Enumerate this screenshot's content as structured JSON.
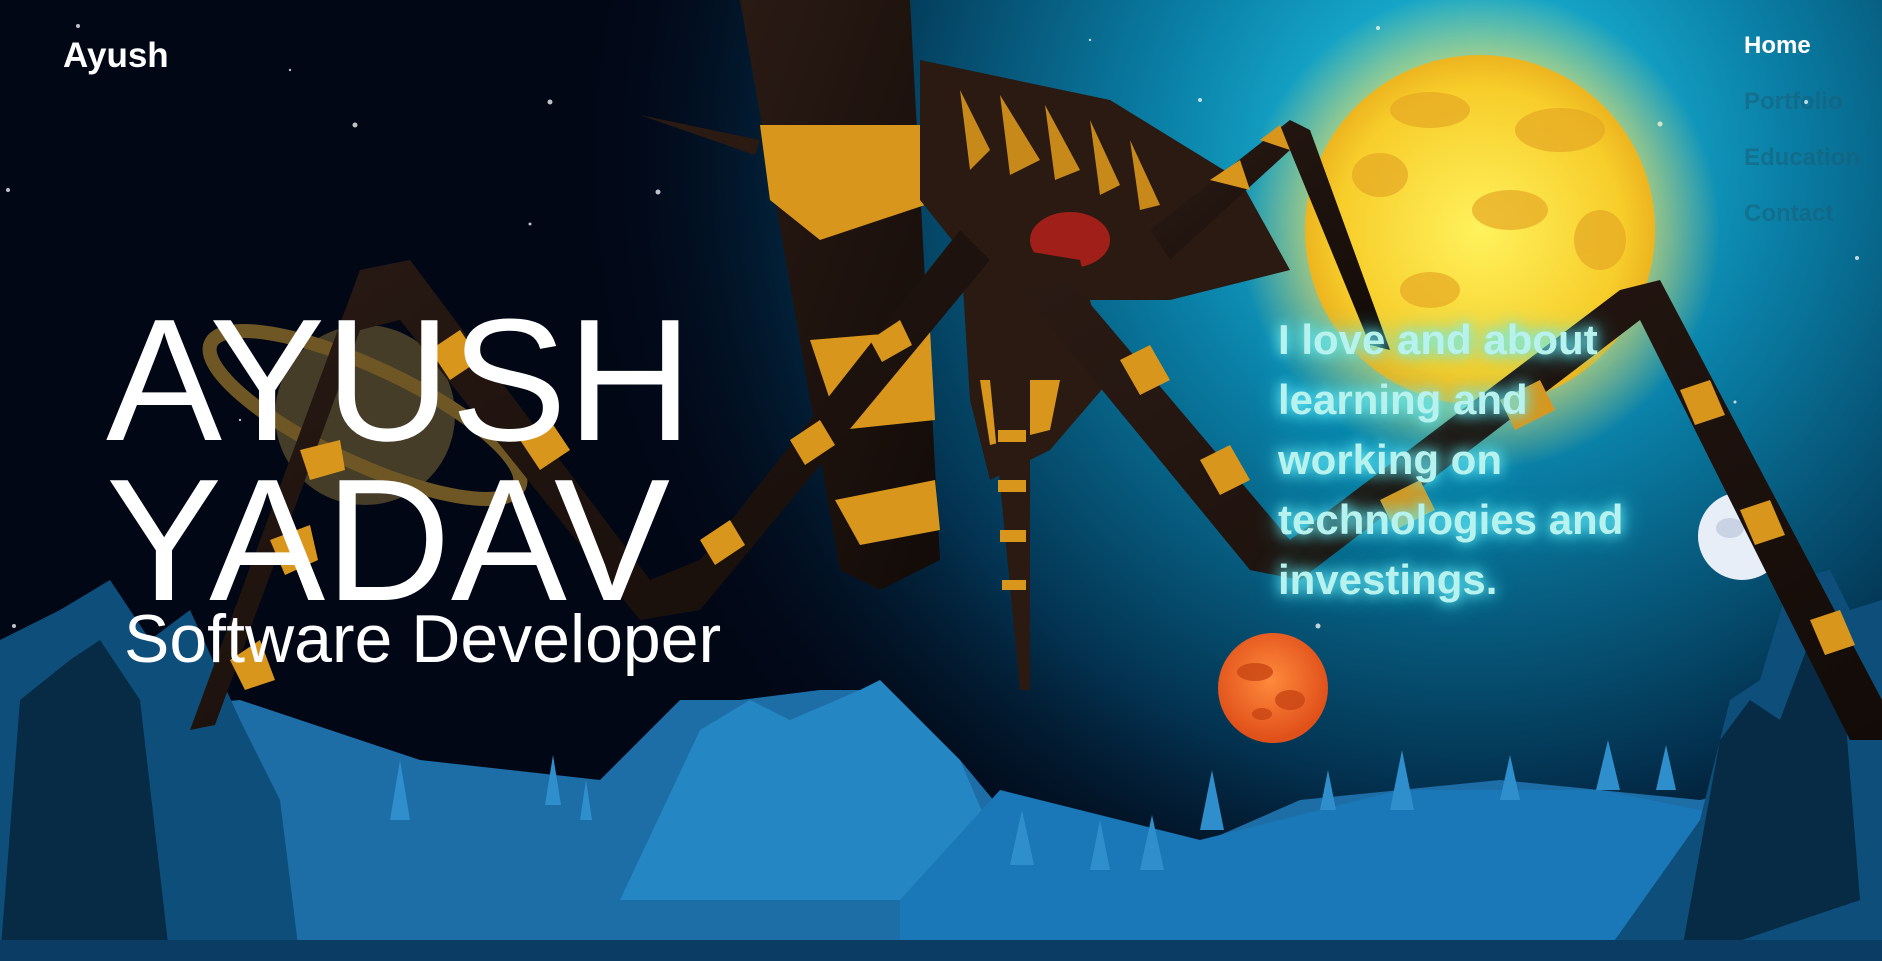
{
  "brand": {
    "name": "Ayush"
  },
  "nav": {
    "items": [
      {
        "label": "Home",
        "active": true
      },
      {
        "label": "Portfolio",
        "active": false
      },
      {
        "label": "Education",
        "active": false
      },
      {
        "label": "Contact",
        "active": false
      }
    ]
  },
  "hero": {
    "first_name": "AYUSH",
    "last_name": "YADAV",
    "role": "Software Developer",
    "bio": "I love and about learning and working on technologies and investings."
  },
  "colors": {
    "sky_dark": "#020716",
    "sky_glow": "#0fa6cc",
    "moon": "#f6d830",
    "mars": "#f26a1c",
    "mountain": "#1f6fa8",
    "creature_band": "#d9961c",
    "creature_dark": "#1e1410",
    "bio_text": "#b8f2ee"
  },
  "icons": {
    "scene": "spider-creature-illustration",
    "moon": "moon-icon",
    "planet_saturn": "saturn-icon",
    "planet_mars": "mars-icon"
  }
}
